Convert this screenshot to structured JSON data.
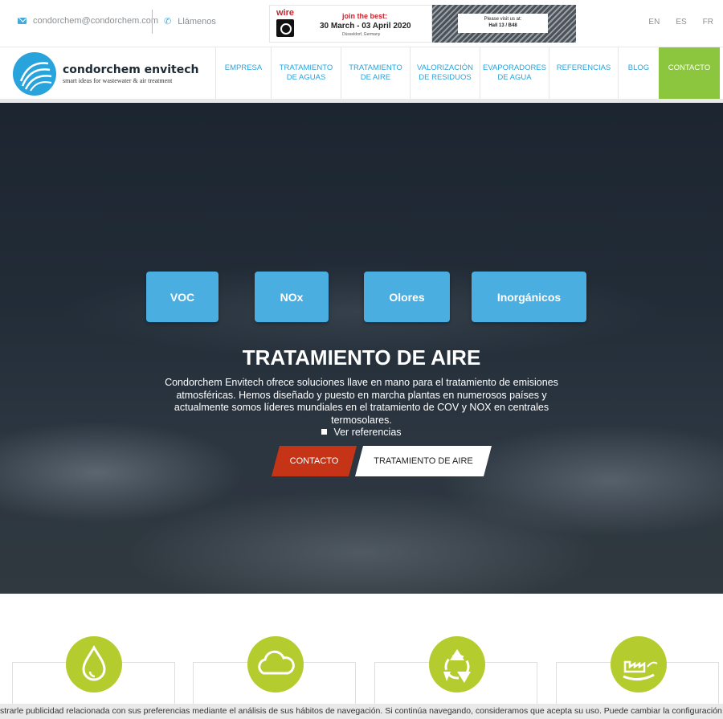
{
  "topbar": {
    "email": "condorchem@condorchem.com",
    "phone_label": "Llámenos",
    "languages": [
      "EN",
      "ES",
      "FR"
    ]
  },
  "banner": {
    "logo_text": "wire",
    "headline": "join the best:",
    "dates": "30 March - 03 April 2020",
    "city": "Düsseldorf, Germany",
    "visit_text": "Please visit us at:",
    "hall": "Hall 13 / B48"
  },
  "brand": {
    "name": "condorchem envitech",
    "tagline": "smart ideas for wastewater & air treatment"
  },
  "nav": {
    "items": [
      {
        "line1": "EMPRESA",
        "line2": ""
      },
      {
        "line1": "TRATAMIENTO",
        "line2": "DE AGUAS"
      },
      {
        "line1": "TRATAMIENTO",
        "line2": "DE AIRE"
      },
      {
        "line1": "VALORIZACIÓN",
        "line2": "DE RESIDUOS"
      },
      {
        "line1": "EVAPORADORES",
        "line2": "DE AGUA"
      },
      {
        "line1": "REFERENCIAS",
        "line2": ""
      },
      {
        "line1": "BLOG",
        "line2": ""
      }
    ],
    "contact": "CONTACTO"
  },
  "hero": {
    "chips": [
      "VOC",
      "NOx",
      "Olores",
      "Inorgánicos"
    ],
    "title": "TRATAMIENTO DE AIRE",
    "text": "Condorchem Envitech ofrece soluciones llave en mano para el tratamiento de emisiones atmosféricas. Hemos diseñado y puesto en marcha plantas en numerosos países y actualmente somos líderes mundiales en el tratamiento de COV y NOX en centrales termosolares.",
    "link": "Ver referencias",
    "button_contact": "CONTACTO",
    "button_air": "TRATAMIENTO DE AIRE"
  },
  "features": {
    "icons": [
      "water-drop-icon",
      "cloud-icon",
      "recycle-icon",
      "factory-icon"
    ],
    "accent": "#b5cc2e"
  },
  "cookie": {
    "text": "strarle publicidad relacionada con sus preferencias mediante el análisis de sus hábitos de navegación. Si continúa navegando, consideramos que acepta su uso. Puede cambiar la configuración u"
  },
  "colors": {
    "primary_blue": "#29a3dc",
    "chip_blue": "#4aaee0",
    "contact_green": "#8cc63f",
    "contact_red": "#c63418"
  }
}
